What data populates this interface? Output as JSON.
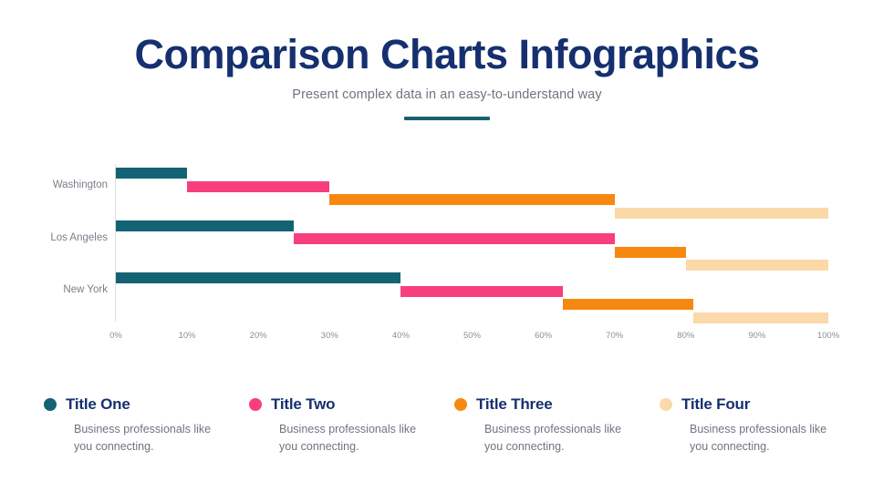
{
  "header": {
    "title": "Comparison Charts Infographics",
    "subtitle": "Present complex data in an easy-to-understand way"
  },
  "colors": {
    "title_navy": "#16306f",
    "body_gray": "#6e7480",
    "teal": "#136374",
    "pink": "#f73f7f",
    "orange": "#f7880f",
    "cream": "#fbd9a8",
    "axis": "#d9dce0"
  },
  "chart_data": {
    "type": "bar",
    "variant": "stacked-staircase-horizontal",
    "title": "",
    "xlabel": "",
    "ylabel": "",
    "xlim": [
      0,
      100
    ],
    "xticks": [
      0,
      10,
      20,
      30,
      40,
      50,
      60,
      70,
      80,
      90,
      100
    ],
    "tick_labels": [
      "0%",
      "10%",
      "20%",
      "30%",
      "40%",
      "50%",
      "60%",
      "70%",
      "80%",
      "90%",
      "100%"
    ],
    "grid": false,
    "legend_position": "bottom",
    "categories": [
      "Washington",
      "Los Angeles",
      "New York"
    ],
    "series": [
      {
        "name": "Title One",
        "color": "#136374",
        "values": [
          10,
          25,
          40
        ],
        "segments": [
          {
            "start": 0,
            "end": 10
          },
          {
            "start": 0,
            "end": 25
          },
          {
            "start": 0,
            "end": 40
          }
        ]
      },
      {
        "name": "Title Two",
        "color": "#f73f7f",
        "values": [
          20,
          45,
          22.7
        ],
        "segments": [
          {
            "start": 10,
            "end": 30
          },
          {
            "start": 25,
            "end": 70
          },
          {
            "start": 40,
            "end": 62.7
          }
        ]
      },
      {
        "name": "Title Three",
        "color": "#f7880f",
        "values": [
          40,
          10,
          18.3
        ],
        "segments": [
          {
            "start": 30,
            "end": 70
          },
          {
            "start": 70,
            "end": 80
          },
          {
            "start": 62.7,
            "end": 81
          }
        ]
      },
      {
        "name": "Title Four",
        "color": "#fbd9a8",
        "values": [
          30,
          20,
          19
        ],
        "segments": [
          {
            "start": 70,
            "end": 100
          },
          {
            "start": 80,
            "end": 100
          },
          {
            "start": 81,
            "end": 100
          }
        ]
      }
    ]
  },
  "legend": [
    {
      "title": "Title One",
      "color": "#136374",
      "description": "Business professionals like you connecting."
    },
    {
      "title": "Title Two",
      "color": "#f73f7f",
      "description": "Business professionals like you connecting."
    },
    {
      "title": "Title Three",
      "color": "#f7880f",
      "description": "Business professionals like you connecting."
    },
    {
      "title": "Title Four",
      "color": "#fbd9a8",
      "description": "Business professionals like you connecting."
    }
  ]
}
